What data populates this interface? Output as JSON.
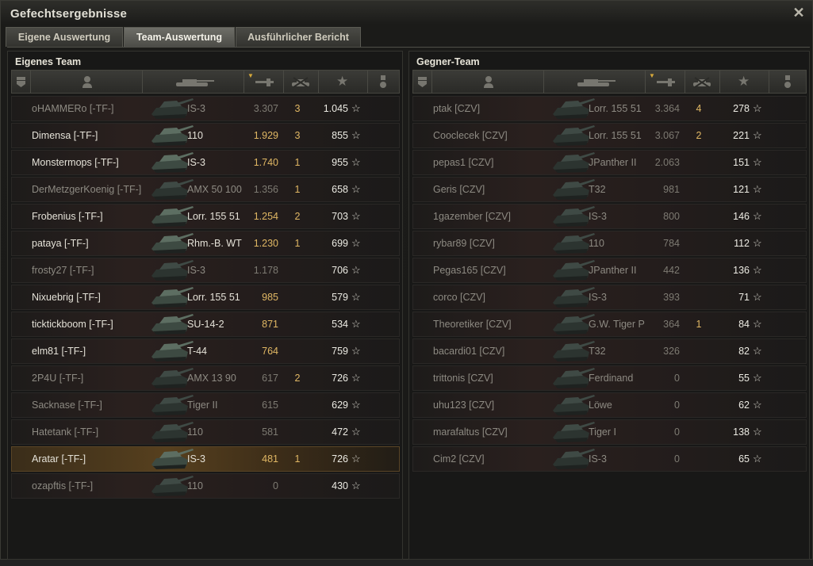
{
  "window": {
    "title": "Gefechtsergebnisse",
    "close_icon": "close-icon"
  },
  "tabs": [
    {
      "label": "Eigene Auswertung",
      "active": false
    },
    {
      "label": "Team-Auswertung",
      "active": true
    },
    {
      "label": "Ausführlicher Bericht",
      "active": false
    }
  ],
  "own_team": {
    "title": "Eigenes Team",
    "rows": [
      {
        "name": "oHAMMERo [-TF-]",
        "tank": "IS-3",
        "damage": "3.307",
        "kills": "3",
        "xp": "1.045",
        "dim": true,
        "self": false
      },
      {
        "name": "Dimensa [-TF-]",
        "tank": "110",
        "damage": "1.929",
        "kills": "3",
        "xp": "855",
        "dim": false,
        "self": false
      },
      {
        "name": "Monstermops [-TF-]",
        "tank": "IS-3",
        "damage": "1.740",
        "kills": "1",
        "xp": "955",
        "dim": false,
        "self": false
      },
      {
        "name": "DerMetzgerKoenig [-TF-]",
        "tank": "AMX 50 100",
        "damage": "1.356",
        "kills": "1",
        "xp": "658",
        "dim": true,
        "self": false
      },
      {
        "name": "Frobenius [-TF-]",
        "tank": "Lorr. 155 51",
        "damage": "1.254",
        "kills": "2",
        "xp": "703",
        "dim": false,
        "self": false
      },
      {
        "name": "pataya [-TF-]",
        "tank": "Rhm.-B. WT",
        "damage": "1.230",
        "kills": "1",
        "xp": "699",
        "dim": false,
        "self": false
      },
      {
        "name": "frosty27 [-TF-]",
        "tank": "IS-3",
        "damage": "1.178",
        "kills": "",
        "xp": "706",
        "dim": true,
        "self": false
      },
      {
        "name": "Nixuebrig [-TF-]",
        "tank": "Lorr. 155 51",
        "damage": "985",
        "kills": "",
        "xp": "579",
        "dim": false,
        "self": false
      },
      {
        "name": "ticktickboom [-TF-]",
        "tank": "SU-14-2",
        "damage": "871",
        "kills": "",
        "xp": "534",
        "dim": false,
        "self": false
      },
      {
        "name": "elm81 [-TF-]",
        "tank": "T-44",
        "damage": "764",
        "kills": "",
        "xp": "759",
        "dim": false,
        "self": false
      },
      {
        "name": "2P4U [-TF-]",
        "tank": "AMX 13 90",
        "damage": "617",
        "kills": "2",
        "xp": "726",
        "dim": true,
        "self": false
      },
      {
        "name": "Sacknase [-TF-]",
        "tank": "Tiger II",
        "damage": "615",
        "kills": "",
        "xp": "629",
        "dim": true,
        "self": false
      },
      {
        "name": "Hatetank [-TF-]",
        "tank": "110",
        "damage": "581",
        "kills": "",
        "xp": "472",
        "dim": true,
        "self": false
      },
      {
        "name": "Aratar [-TF-]",
        "tank": "IS-3",
        "damage": "481",
        "kills": "1",
        "xp": "726",
        "dim": false,
        "self": true
      },
      {
        "name": "ozapftis [-TF-]",
        "tank": "110",
        "damage": "0",
        "kills": "",
        "xp": "430",
        "dim": true,
        "self": false
      }
    ]
  },
  "enemy_team": {
    "title": "Gegner-Team",
    "rows": [
      {
        "name": "ptak [CZV]",
        "tank": "Lorr. 155 51",
        "damage": "3.364",
        "kills": "4",
        "xp": "278",
        "dim": true,
        "self": false
      },
      {
        "name": "Cooclecek [CZV]",
        "tank": "Lorr. 155 51",
        "damage": "3.067",
        "kills": "2",
        "xp": "221",
        "dim": true,
        "self": false
      },
      {
        "name": "pepas1 [CZV]",
        "tank": "JPanther II",
        "damage": "2.063",
        "kills": "",
        "xp": "151",
        "dim": true,
        "self": false
      },
      {
        "name": "Geris [CZV]",
        "tank": "T32",
        "damage": "981",
        "kills": "",
        "xp": "121",
        "dim": true,
        "self": false
      },
      {
        "name": "1gazember [CZV]",
        "tank": "IS-3",
        "damage": "800",
        "kills": "",
        "xp": "146",
        "dim": true,
        "self": false
      },
      {
        "name": "rybar89 [CZV]",
        "tank": "110",
        "damage": "784",
        "kills": "",
        "xp": "112",
        "dim": true,
        "self": false
      },
      {
        "name": "Pegas165 [CZV]",
        "tank": "JPanther II",
        "damage": "442",
        "kills": "",
        "xp": "136",
        "dim": true,
        "self": false
      },
      {
        "name": "corco [CZV]",
        "tank": "IS-3",
        "damage": "393",
        "kills": "",
        "xp": "71",
        "dim": true,
        "self": false
      },
      {
        "name": "Theoretiker [CZV]",
        "tank": "G.W. Tiger P",
        "damage": "364",
        "kills": "1",
        "xp": "84",
        "dim": true,
        "self": false
      },
      {
        "name": "bacardi01 [CZV]",
        "tank": "T32",
        "damage": "326",
        "kills": "",
        "xp": "82",
        "dim": true,
        "self": false
      },
      {
        "name": "trittonis [CZV]",
        "tank": "Ferdinand",
        "damage": "0",
        "kills": "",
        "xp": "55",
        "dim": true,
        "self": false
      },
      {
        "name": "uhu123 [CZV]",
        "tank": "Löwe",
        "damage": "0",
        "kills": "",
        "xp": "62",
        "dim": true,
        "self": false
      },
      {
        "name": "marafaltus [CZV]",
        "tank": "Tiger I",
        "damage": "0",
        "kills": "",
        "xp": "138",
        "dim": true,
        "self": false
      },
      {
        "name": "Cim2 [CZV]",
        "tank": "IS-3",
        "damage": "0",
        "kills": "",
        "xp": "65",
        "dim": true,
        "self": false
      }
    ]
  },
  "columns": [
    "platoon-icon",
    "player-icon",
    "tank-icon",
    "damage-icon",
    "kills-icon",
    "xp-star-icon",
    "medal-icon"
  ],
  "colors": {
    "damage": "#e0b764",
    "kills": "#e0b764",
    "dim_text": "#8d8a82",
    "text": "#e4e1d7"
  }
}
